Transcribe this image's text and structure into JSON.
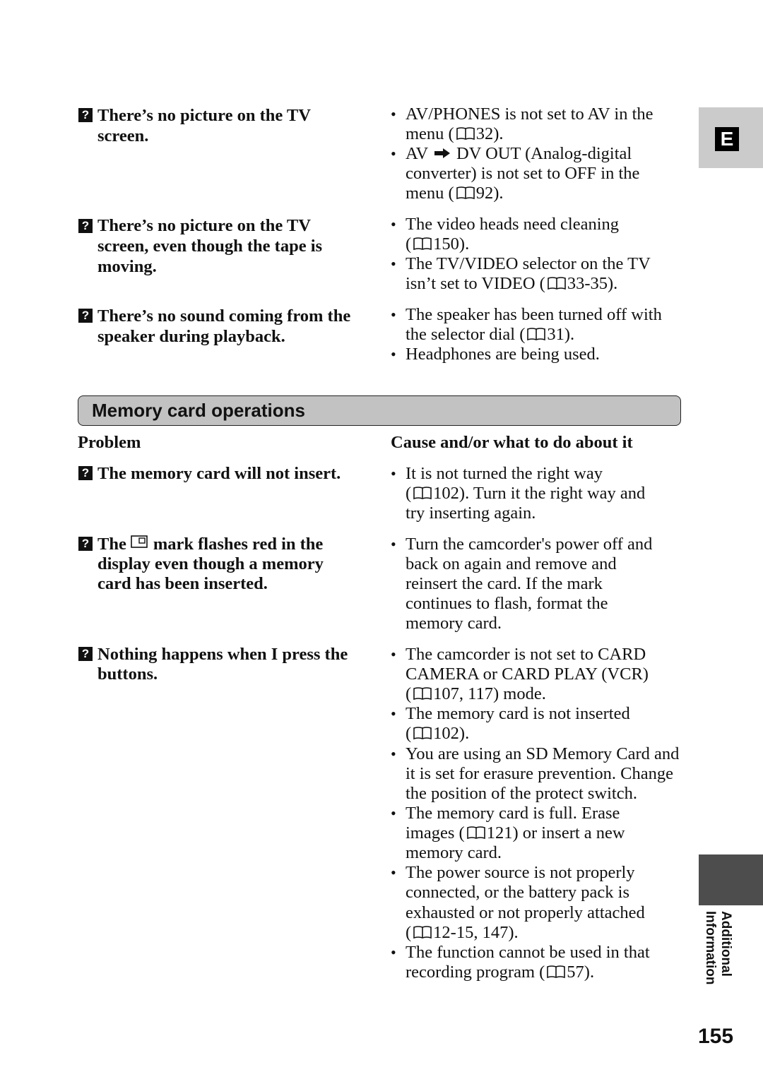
{
  "side_tab": {
    "letter": "E",
    "section_label_line1": "Additional",
    "section_label_line2": "Information"
  },
  "page_number": "155",
  "icons": {
    "question": "?",
    "book_ref": "book-icon",
    "arrow": "➡",
    "card_mark": "memory-card-icon"
  },
  "top_section": {
    "problems": [
      {
        "lines": [
          "There’s no picture on the TV",
          "screen."
        ]
      },
      {
        "lines": [
          "There’s no picture on the TV",
          "screen, even though the tape is",
          "moving."
        ]
      },
      {
        "lines": [
          "There’s no sound coming from the",
          "speaker during playback."
        ]
      }
    ],
    "causes": [
      {
        "lines": [
          "AV/PHONES is not set to AV in the",
          "menu (",
          "32)."
        ]
      },
      {
        "lines": [
          "AV",
          "DV OUT (Analog-digital",
          "converter) is not set to OFF in the",
          "menu (",
          "92)."
        ]
      },
      {
        "lines": [
          "The video heads need cleaning",
          "(",
          "150)."
        ]
      },
      {
        "lines": [
          "The TV/VIDEO selector on the TV",
          "isn’t set to VIDEO (",
          "33-35)."
        ]
      },
      {
        "lines": [
          "The speaker has been turned off with",
          "the selector dial (",
          "31)."
        ]
      },
      {
        "lines": [
          "Headphones are being used."
        ]
      }
    ]
  },
  "memory_section": {
    "title": "Memory card operations",
    "col_problem": "Problem",
    "col_cause": "Cause and/or what to do about it",
    "problems": [
      {
        "lines": [
          "The memory card will not insert."
        ]
      },
      {
        "lines": [
          "The",
          "mark flashes red in the",
          "display even though a memory",
          "card has been inserted."
        ]
      },
      {
        "lines": [
          "Nothing happens when I press the",
          "buttons."
        ]
      }
    ],
    "causes": [
      {
        "lines": [
          "It is not turned the right way",
          "(",
          "102). Turn it the right way and",
          "try inserting again."
        ]
      },
      {
        "lines": [
          "Turn the camcorder's power off and",
          "back on again and remove and",
          "reinsert the card. If the mark",
          "continues to flash, format the",
          "memory card."
        ]
      },
      {
        "lines": [
          "The camcorder is not set to CARD",
          "CAMERA or CARD PLAY (VCR)",
          "(",
          "107, 117) mode."
        ]
      },
      {
        "lines": [
          "The memory card is not inserted",
          "(",
          "102)."
        ]
      },
      {
        "lines": [
          "You are using an SD Memory Card and",
          "it is set for erasure prevention. Change",
          "the position of the protect switch."
        ]
      },
      {
        "lines": [
          "The memory card is full. Erase",
          "images (",
          "121) or insert a new",
          "memory card."
        ]
      },
      {
        "lines": [
          "The power source is not properly",
          "connected, or the battery pack is",
          "exhausted or not properly attached",
          "(",
          "12-15, 147)."
        ]
      },
      {
        "lines": [
          "The function cannot be used in that",
          "recording program (",
          "57)."
        ]
      }
    ],
    "bullet": "•"
  }
}
